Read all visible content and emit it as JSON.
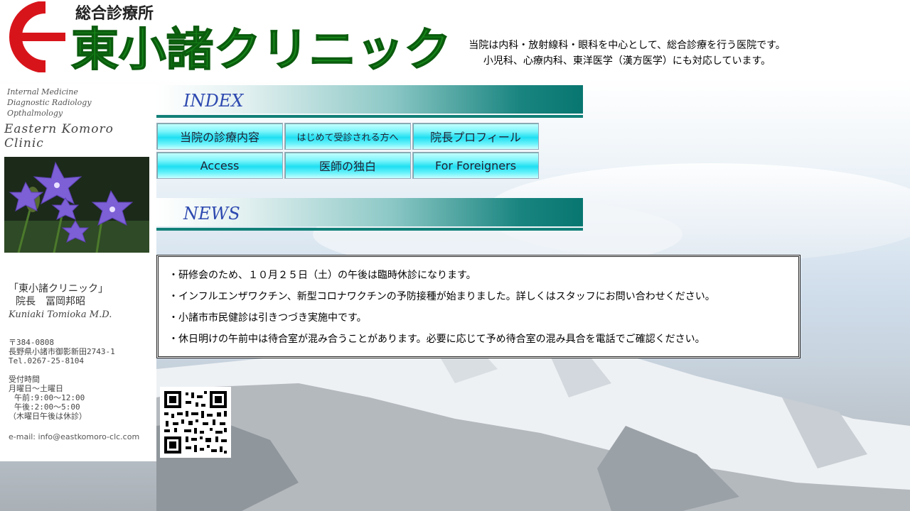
{
  "header": {
    "logo_small": "総合診療所",
    "logo_main": "東小諸クリニック",
    "desc_line1": "当院は内科・放射線科・眼科を中心として、総合診療を行う医院です。",
    "desc_line2": "小児科、心療内科、東洋医学（漢方医学）にも対応しています。"
  },
  "sidebar": {
    "specialties": [
      "Internal Medicine",
      "Diagnostic Radiology",
      "Opthalmology"
    ],
    "brand": "Eastern Komoro Clinic",
    "clinic_name": "「東小諸クリニック」",
    "director": "院長　冨岡邦昭",
    "signature": "Kuniaki Tomioka M.D.",
    "postal": "〒384-0808",
    "address": "長野県小諸市御影新田2743-1",
    "tel": "Tel.0267-25-8104",
    "hours_title": "受付時間",
    "hours_days": "月曜日～土曜日",
    "hours_am": "午前:9:00～12:00",
    "hours_pm": "午後:2:00～5:00",
    "hours_note": "（木曜日午後は休診）",
    "email": "e-mail: info@eastkomoro-clc.com"
  },
  "index_title": "INDEX",
  "nav": [
    "当院の診療内容",
    "はじめて受診される方へ",
    "院長プロフィール",
    "Access",
    "医師の独白",
    "For Foreigners"
  ],
  "news_title": "NEWS",
  "news": [
    "・研修会のため、１０月２５日（土）の午後は臨時休診になります。",
    "・インフルエンザワクチン、新型コロナワクチンの予防接種が始まりました。詳しくはスタッフにお問い合わせください。",
    "・小諸市市民健診は引きつづき実施中です。",
    "・休日明けの午前中は待合室が混み合うことがあります。必要に応じて予め待合室の混み具合を電話でご確認ください。"
  ],
  "colors": {
    "accent_green": "#1a8a1a",
    "logo_red": "#d8141b",
    "teal": "#087670",
    "index_blue": "#2d49b0",
    "button_cyan": "#1fdff2"
  }
}
